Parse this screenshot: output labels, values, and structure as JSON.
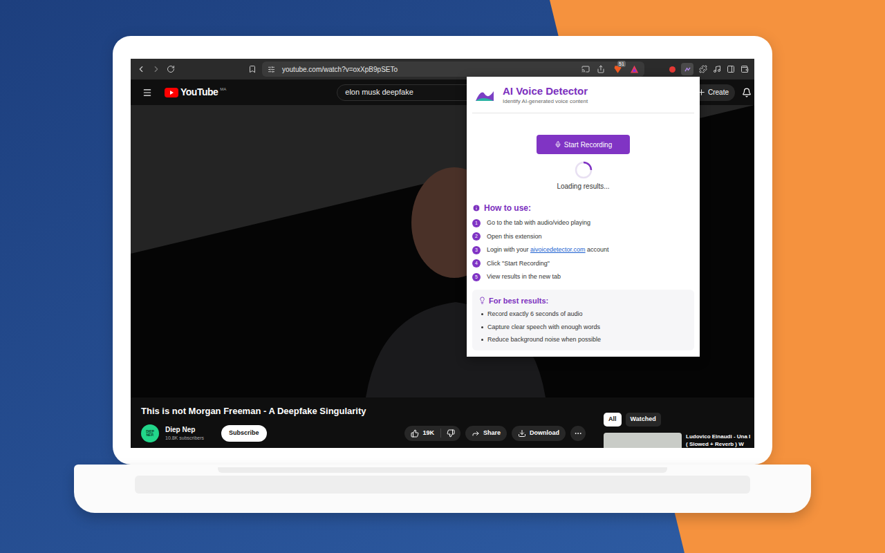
{
  "browser": {
    "url": "youtube.com/watch?v=oxXpB9pSETo",
    "shields_badge": "51"
  },
  "youtube": {
    "logo": "YouTube",
    "region": "MA",
    "search": "elon musk deepfake",
    "create": "Create",
    "video": {
      "title": "This is not Morgan Freeman - A Deepfake Singularity",
      "channel": "Diep Nep",
      "avatar": "DIEP NEP.",
      "subscribers": "10.8K subscribers",
      "subscribe": "Subscribe",
      "likes": "19K",
      "share": "Share",
      "download": "Download"
    },
    "chips": [
      {
        "label": "All",
        "selected": true
      },
      {
        "label": "Watched",
        "selected": false
      }
    ],
    "suggestions": [
      {
        "title_lines": [
          "Ludovico Einaudi - Una I",
          "( Slowed + Reverb ) W"
        ]
      }
    ]
  },
  "extension": {
    "title": "AI Voice Detector",
    "subtitle": "Identify AI-generated voice content",
    "button": "Start Recording",
    "loading": "Loading results...",
    "how_to_title": "How to use:",
    "steps": [
      {
        "number": "1",
        "parts": [
          {
            "text": "Go to the tab with audio/video playing",
            "link": false
          }
        ]
      },
      {
        "number": "2",
        "parts": [
          {
            "text": "Open this extension",
            "link": false
          }
        ]
      },
      {
        "number": "3",
        "parts": [
          {
            "text": "Login with your ",
            "link": false
          },
          {
            "text": "aivoicedetector.com",
            "link": true
          },
          {
            "text": " account",
            "link": false
          }
        ]
      },
      {
        "number": "4",
        "parts": [
          {
            "text": "Click \"Start Recording\"",
            "link": false
          }
        ]
      },
      {
        "number": "5",
        "parts": [
          {
            "text": "View results in the new tab",
            "link": false
          }
        ]
      }
    ],
    "tips_title": "For best results:",
    "tips": [
      "Record exactly 6 seconds of audio",
      "Capture clear speech with enough words",
      "Reduce background noise when possible"
    ]
  }
}
